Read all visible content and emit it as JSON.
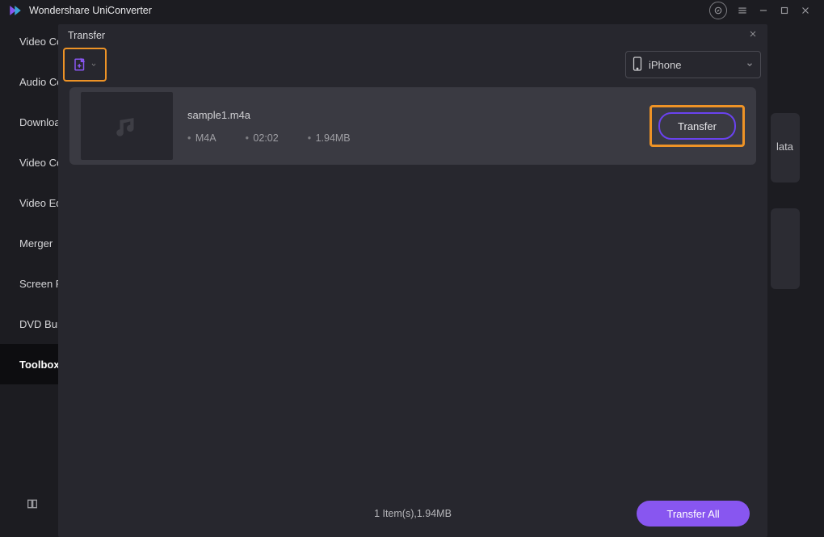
{
  "titlebar": {
    "app_name": "Wondershare UniConverter"
  },
  "sidebar": {
    "items": [
      {
        "label": "Video Converter"
      },
      {
        "label": "Audio Converter"
      },
      {
        "label": "Downloader"
      },
      {
        "label": "Video Compressor"
      },
      {
        "label": "Video Editor"
      },
      {
        "label": "Merger"
      },
      {
        "label": "Screen Recorder"
      },
      {
        "label": "DVD Burner"
      },
      {
        "label": "Toolbox"
      }
    ],
    "active_index": 8
  },
  "background": {
    "card1_text": "lata"
  },
  "modal": {
    "title": "Transfer",
    "device": {
      "label": "iPhone"
    },
    "files": [
      {
        "name": "sample1.m4a",
        "format": "M4A",
        "duration": "02:02",
        "size": "1.94MB",
        "action": "Transfer"
      }
    ],
    "footer": {
      "summary": "1 Item(s),1.94MB",
      "transfer_all": "Transfer All"
    }
  }
}
